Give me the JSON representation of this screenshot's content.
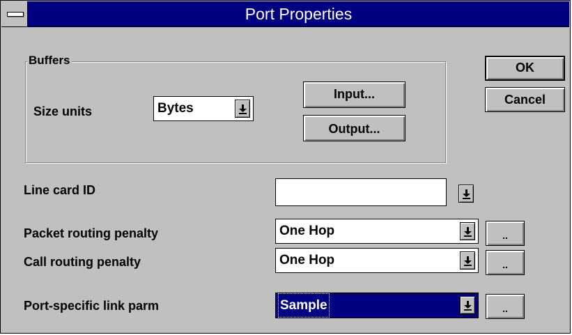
{
  "window": {
    "title": "Port Properties"
  },
  "buffers": {
    "group_label": "Buffers",
    "size_units_label": "Size units",
    "size_units_value": "Bytes",
    "input_button": "Input...",
    "output_button": "Output..."
  },
  "buttons": {
    "ok": "OK",
    "cancel": "Cancel"
  },
  "line_card": {
    "label": "Line card ID",
    "value": ""
  },
  "packet_routing": {
    "label": "Packet routing penalty",
    "value": "One Hop",
    "more_button": ".."
  },
  "call_routing": {
    "label": "Call routing penalty",
    "value": "One Hop",
    "more_button": ".."
  },
  "port_link_parm": {
    "label": "Port-specific link parm",
    "value": "Sample",
    "more_button": ".."
  },
  "icons": {
    "system_menu": "system-menu-icon",
    "dropdown": "dropdown-arrow-icon"
  },
  "colors": {
    "title_bar": "#000080",
    "dialog_face": "#c0c0c0",
    "selection": "#000080"
  }
}
